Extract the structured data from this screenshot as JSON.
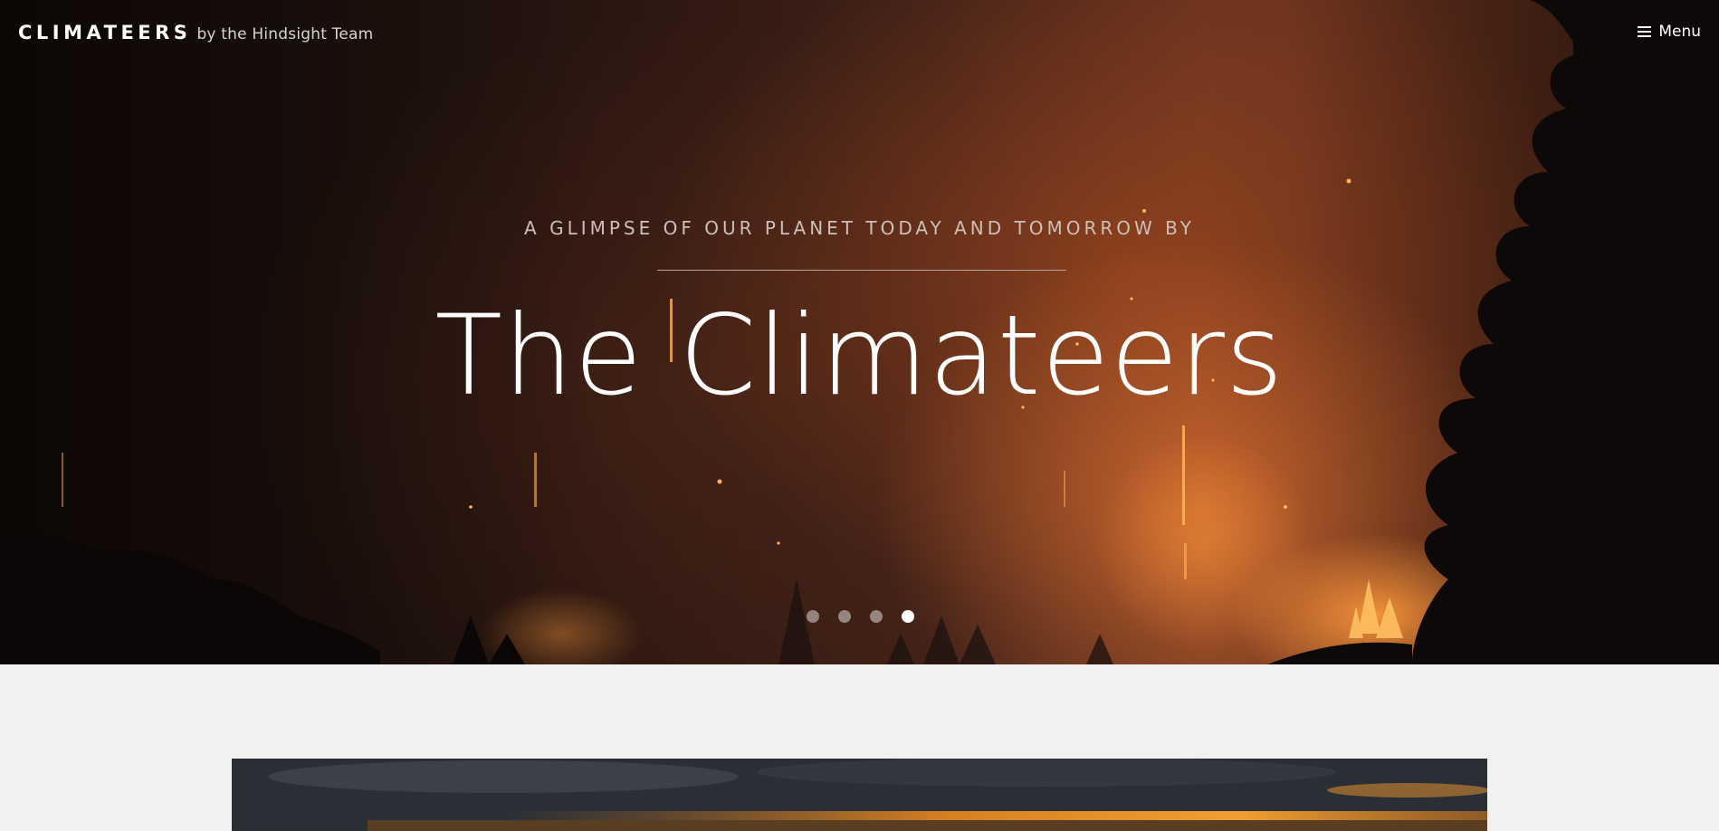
{
  "header": {
    "brand_name": "CLIMATEERS",
    "brand_sub": "by the Hindsight Team",
    "menu_label": "Menu",
    "menu_icon": "hamburger-icon"
  },
  "hero": {
    "kicker": "A GLIMPSE OF OUR PLANET TODAY AND TOMORROW BY",
    "title": "The Climateers",
    "image": "forest-fire-night",
    "slides": 4,
    "active_slide": 4
  },
  "content": {
    "image": "stormy-sunset-sky"
  },
  "colors": {
    "page_background": "#f1f1f1",
    "text_light": "#ffffff",
    "kicker": "#cdbfb9",
    "fire_orange": "#d66e30"
  }
}
